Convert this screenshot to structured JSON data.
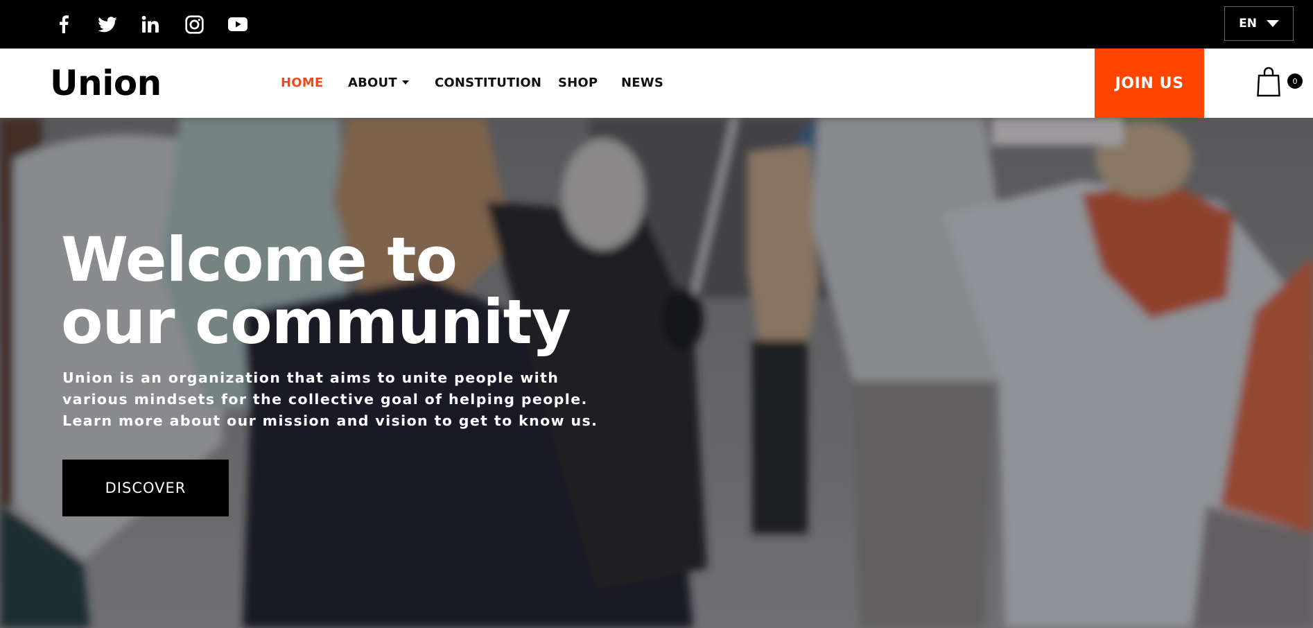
{
  "topbar": {
    "social": [
      {
        "icon": "facebook-icon",
        "label": "Facebook"
      },
      {
        "icon": "twitter-icon",
        "label": "Twitter"
      },
      {
        "icon": "linkedin-icon",
        "label": "LinkedIn"
      },
      {
        "icon": "instagram-icon",
        "label": "Instagram"
      },
      {
        "icon": "youtube-icon",
        "label": "YouTube"
      }
    ],
    "language": "EN"
  },
  "nav": {
    "logo": "Union",
    "items": [
      {
        "label": "HOME",
        "active": true
      },
      {
        "label": "ABOUT",
        "has_dropdown": true
      },
      {
        "label": "CONSTITUTION"
      },
      {
        "label": "SHOP"
      },
      {
        "label": "NEWS"
      }
    ],
    "cta": "JOIN US",
    "cart_count": "0"
  },
  "hero": {
    "title_lines": [
      "Welcome to",
      "our community"
    ],
    "description_lines": [
      "Union is an organization that aims to unite people with",
      "various mindsets for the collective goal of helping people.",
      "Learn more about our mission and vision to get to know us."
    ],
    "button": "DISCOVER"
  },
  "colors": {
    "accent": "#ff4500",
    "active_nav": "#ee4a1c",
    "topbar": "#000000",
    "nav_bg": "#ffffff"
  }
}
